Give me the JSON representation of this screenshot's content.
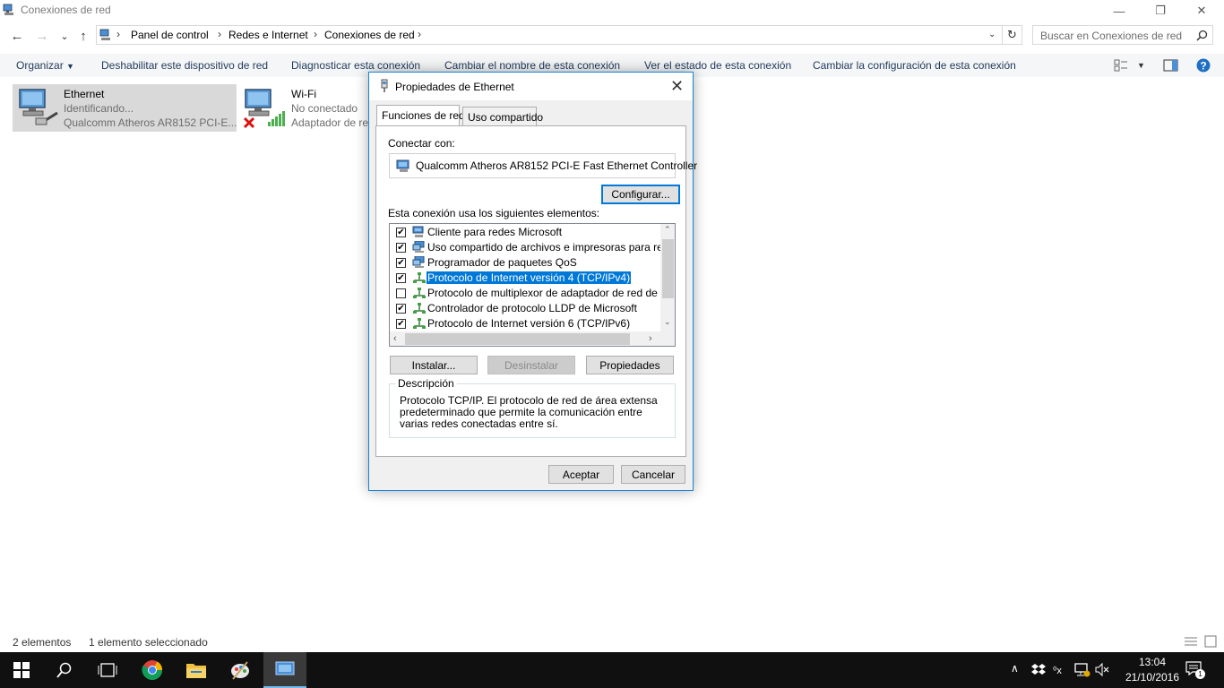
{
  "window": {
    "title": "Conexiones de red",
    "minimize": "—",
    "maximize": "❐",
    "close": "✕"
  },
  "nav": {
    "back": "←",
    "forward": "→",
    "recent": "⌄",
    "up": "↑",
    "breadcrumb": [
      "Panel de control",
      "Redes e Internet",
      "Conexiones de red"
    ],
    "search_placeholder": "Buscar en Conexiones de red"
  },
  "commands": {
    "organize": "Organizar",
    "disable": "Deshabilitar este dispositivo de red",
    "diagnose": "Diagnosticar esta conexión",
    "rename": "Cambiar el nombre de esta conexión",
    "status": "Ver el estado de esta conexión",
    "settings": "Cambiar la configuración de esta conexión"
  },
  "connections": [
    {
      "name": "Ethernet",
      "status": "Identificando...",
      "device": "Qualcomm Atheros AR8152 PCI-E...",
      "selected": true
    },
    {
      "name": "Wi-Fi",
      "status": "No conectado",
      "device": "Adaptador de re",
      "selected": false
    }
  ],
  "status_bar": {
    "count": "2 elementos",
    "selection": "1 elemento seleccionado"
  },
  "taskbar": {
    "time": "13:04",
    "date": "21/10/2016",
    "notifications": "1"
  },
  "dialog": {
    "title": "Propiedades de Ethernet",
    "tabs": [
      {
        "label": "Funciones de red",
        "active": true
      },
      {
        "label": "Uso compartido",
        "active": false
      }
    ],
    "connect_with_label": "Conectar con:",
    "adapter_name": "Qualcomm Atheros AR8152 PCI-E Fast Ethernet Controller",
    "configure_button": "Configurar...",
    "items_label": "Esta conexión usa los siguientes elementos:",
    "items": [
      {
        "label": "Cliente para redes Microsoft",
        "checked": true,
        "selected": false,
        "icon": "network-client-icon"
      },
      {
        "label": "Uso compartido de archivos e impresoras para redes M",
        "checked": true,
        "selected": false,
        "icon": "network-service-icon"
      },
      {
        "label": "Programador de paquetes QoS",
        "checked": true,
        "selected": false,
        "icon": "network-service-icon"
      },
      {
        "label": "Protocolo de Internet versión 4 (TCP/IPv4)",
        "checked": true,
        "selected": true,
        "icon": "protocol-icon"
      },
      {
        "label": "Protocolo de multiplexor de adaptador de red de Micros",
        "checked": false,
        "selected": false,
        "icon": "protocol-icon"
      },
      {
        "label": "Controlador de protocolo LLDP de Microsoft",
        "checked": true,
        "selected": false,
        "icon": "protocol-icon"
      },
      {
        "label": "Protocolo de Internet versión 6 (TCP/IPv6)",
        "checked": true,
        "selected": false,
        "icon": "protocol-icon"
      }
    ],
    "install_button": "Instalar...",
    "uninstall_button": "Desinstalar",
    "properties_button": "Propiedades",
    "description_legend": "Descripción",
    "description_text": "Protocolo TCP/IP. El protocolo de red de área extensa predeterminado que permite la comunicación entre varias redes conectadas entre sí.",
    "ok_button": "Aceptar",
    "cancel_button": "Cancelar"
  },
  "colors": {
    "accent": "#0078d7",
    "command_text": "#1e395b",
    "selected_item_bg": "#d9d9d9",
    "taskbar_bg": "#101010"
  }
}
